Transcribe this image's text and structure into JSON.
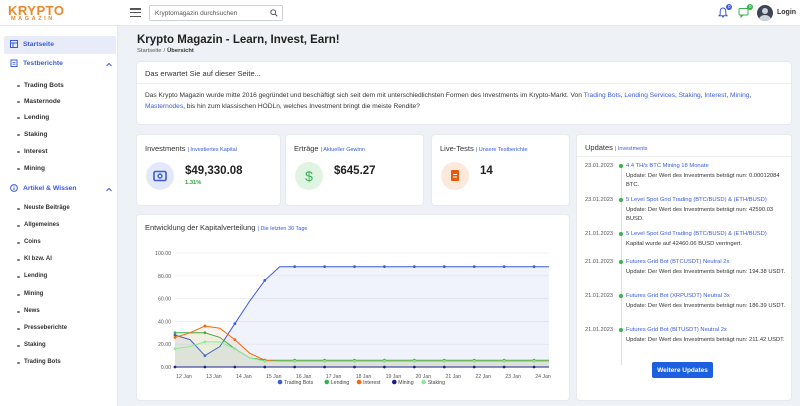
{
  "brand": {
    "logo_main": "KRYPTO",
    "logo_sub": "MAGAZIN"
  },
  "search": {
    "placeholder": "Kryptomagazin durchsuchen"
  },
  "header": {
    "bell_count": "0",
    "chat_count": "0",
    "login_label": "Login"
  },
  "sidebar": {
    "home_label": "Startseite",
    "section1": {
      "label": "Testberichte",
      "items": [
        "Trading Bots",
        "Masternode",
        "Lending",
        "Staking",
        "Interest",
        "Mining"
      ]
    },
    "section2": {
      "label": "Artikel & Wissen",
      "items": [
        "Neuste Beiträge",
        "Allgemeines",
        "Coins",
        "KI bzw. AI",
        "Lending",
        "Mining",
        "News",
        "Presseberichte",
        "Staking",
        "Trading Bots"
      ]
    }
  },
  "page": {
    "title": "Krypto Magazin - Learn, Invest, Earn!",
    "breadcrumb": [
      "Startseite",
      "Übersicht"
    ]
  },
  "intro": {
    "heading": "Das erwartet Sie auf dieser Seite...",
    "text_before": "Das Krypto Magazin wurde mitte 2016 gegründet und beschäftigt sich seit dem mit unterschiedlichsten Formen des Investments im Krypto-Markt. Von ",
    "links": [
      "Trading Bots",
      "Lending Services",
      "Staking",
      "Interest",
      "Mining",
      "Masternodes"
    ],
    "text_after": ", bis hin zum klassischen HODLn, welches Investment bringt die meiste Rendite?"
  },
  "stats": [
    {
      "title": "Investments",
      "subtitle": "Investiertes Kapital",
      "value": "$49,330.08",
      "change": "1.31%",
      "icon": "wallet-icon",
      "color": "#3b5bdb"
    },
    {
      "title": "Erträge",
      "subtitle": "Aktueller Gewinn",
      "value": "$645.27",
      "change": "",
      "icon": "dollar-icon",
      "color": "#37b24d"
    },
    {
      "title": "Live-Tests",
      "subtitle": "Unsere Testberichte",
      "value": "14",
      "change": "",
      "icon": "document-icon",
      "color": "#e8590c"
    }
  ],
  "chart": {
    "title": "Entwicklung der Kapitalverteilung",
    "subtitle": "Die letzten 30 Tage"
  },
  "chart_data": {
    "type": "line",
    "x": [
      "12 Jan",
      "13 Jan",
      "14 Jan",
      "15 Jan",
      "16 Jan",
      "17 Jan",
      "18 Jan",
      "19 Jan",
      "20 Jan",
      "21 Jan",
      "22 Jan",
      "23 Jan",
      "24 Jan"
    ],
    "x_points": [
      0,
      0.5,
      1,
      1.5,
      2,
      2.5,
      3,
      3.5,
      4,
      4.5,
      5,
      5.5,
      6,
      6.5,
      7,
      7.5,
      8,
      8.5,
      9,
      9.5,
      10,
      10.5,
      11,
      11.5,
      12,
      12.5
    ],
    "ylim": [
      0,
      100
    ],
    "yticks": [
      "0.00",
      "20.00",
      "40.00",
      "60.00",
      "80.00",
      "100.00"
    ],
    "legend_position": "bottom",
    "series": [
      {
        "name": "Trading Bots",
        "color": "#3b5bdb",
        "values": [
          28,
          24,
          10,
          18,
          38,
          58,
          76,
          88,
          88,
          88,
          88,
          88,
          88,
          88,
          88,
          88,
          88,
          88,
          88,
          88,
          88,
          88,
          88,
          88,
          88,
          88
        ]
      },
      {
        "name": "Lending",
        "color": "#37b24d",
        "values": [
          30,
          30,
          30,
          26,
          16,
          8,
          6,
          6,
          6,
          6,
          6,
          6,
          6,
          6,
          6,
          6,
          6,
          6,
          6,
          6,
          6,
          6,
          6,
          6,
          6,
          6
        ]
      },
      {
        "name": "Interest",
        "color": "#f76707",
        "values": [
          26,
          30,
          36,
          34,
          24,
          12,
          6,
          5,
          5,
          5,
          5,
          5,
          5,
          5,
          5,
          5,
          5,
          5,
          5,
          5,
          5,
          5,
          5,
          5,
          5,
          5
        ]
      },
      {
        "name": "Mining",
        "color": "#1c1c8c",
        "values": [
          0,
          0,
          0,
          0,
          0,
          0,
          0,
          0,
          0,
          0,
          0,
          0,
          0,
          0,
          0,
          0,
          0,
          0,
          0,
          0,
          0,
          0,
          0,
          0,
          0,
          0
        ]
      },
      {
        "name": "Staking",
        "color": "#8ce99a",
        "values": [
          16,
          18,
          22,
          22,
          16,
          8,
          5,
          5,
          5,
          5,
          5,
          5,
          5,
          5,
          5,
          5,
          5,
          5,
          5,
          5,
          5,
          5,
          5,
          5,
          5,
          5
        ]
      }
    ]
  },
  "updates": {
    "title": "Updates",
    "subtitle": "Investments",
    "items": [
      {
        "date": "23.01.2023",
        "title": "4.4 TH/s BTC Mining 18 Monate",
        "body": "Update: Der Wert des Investments beträgt nun: 0.00012084 BTC."
      },
      {
        "date": "23.01.2023",
        "title": "5 Level Spot Grid Trading (BTC/BUSD) & (ETH/BUSD)",
        "body": "Update: Der Wert des Investments beträgt nun: 42590.03 BUSD."
      },
      {
        "date": "21.01.2023",
        "title": "5 Level Spot Grid Trading (BTC/BUSD) & (ETH/BUSD)",
        "body": "Kapital wurde auf 42460.06 BUSD verringert."
      },
      {
        "date": "21.01.2023",
        "title": "Futures Grid Bot (BTCUSDT) Neutral 2x",
        "body": "Update: Der Wert des Investments beträgt nun: 194.38 USDT."
      },
      {
        "date": "21.01.2023",
        "title": "Futures Grid Bot (XRPUSDT) Neutral 3x",
        "body": "Update: Der Wert des Investments beträgt nun: 186.39 USDT."
      },
      {
        "date": "21.01.2023",
        "title": "Futures Grid Bot (BITUSDT) Neutral 2x",
        "body": "Update: Der Wert des Investments beträgt nun: 211.42 USDT."
      }
    ],
    "button_label": "Weitere Updates"
  }
}
